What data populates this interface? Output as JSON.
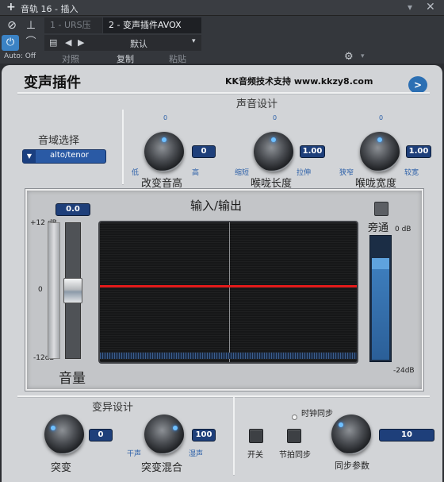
{
  "window": {
    "title": "音轨 16 - 插入"
  },
  "host": {
    "tabs": [
      {
        "label": "1 - URS压缩"
      },
      {
        "label": "2 - 变声插件AVOX"
      }
    ],
    "auto_label": "Auto: Off",
    "preset": "默认",
    "actions": {
      "compare": "对照",
      "copy": "复制",
      "paste": "粘贴"
    }
  },
  "plugin": {
    "title": "变声插件",
    "brand": "KK音频技术支持 www.kkzy8.com",
    "voice_design": {
      "title": "声音设计",
      "range": {
        "label": "音域选择",
        "value": "alto/tenor"
      },
      "pitch": {
        "zero": "0",
        "low": "低",
        "high": "高",
        "name": "改变音高",
        "value": "0"
      },
      "throat_length": {
        "zero": "0",
        "low": "缩短",
        "high": "拉伸",
        "name": "喉咙长度",
        "value": "1.00"
      },
      "throat_width": {
        "zero": "0",
        "low": "狭窄",
        "high": "较宽",
        "name": "喉咙宽度",
        "value": "1.00"
      }
    },
    "io": {
      "title": "输入/输出",
      "volume_value": "0.0",
      "volume_label": "音量",
      "scale": {
        "top": "+12 dB",
        "mid": "0",
        "bottom": "-12dB"
      },
      "bypass_label": "旁通",
      "bypass_scale": {
        "top": "0 dB",
        "bottom": "-24dB"
      },
      "bypass_level": 0.82
    },
    "mutation": {
      "title": "变异设计",
      "mutate": {
        "name": "突变",
        "value": "0"
      },
      "mix": {
        "dry": "干声",
        "wet": "湿声",
        "name": "突变混合",
        "value": "100"
      },
      "switch_label": "开关",
      "clock_sync_label": "时钟同步",
      "beat_sync_label": "节拍同步",
      "sync_param": {
        "name": "同步参数",
        "value": "10"
      }
    }
  }
}
